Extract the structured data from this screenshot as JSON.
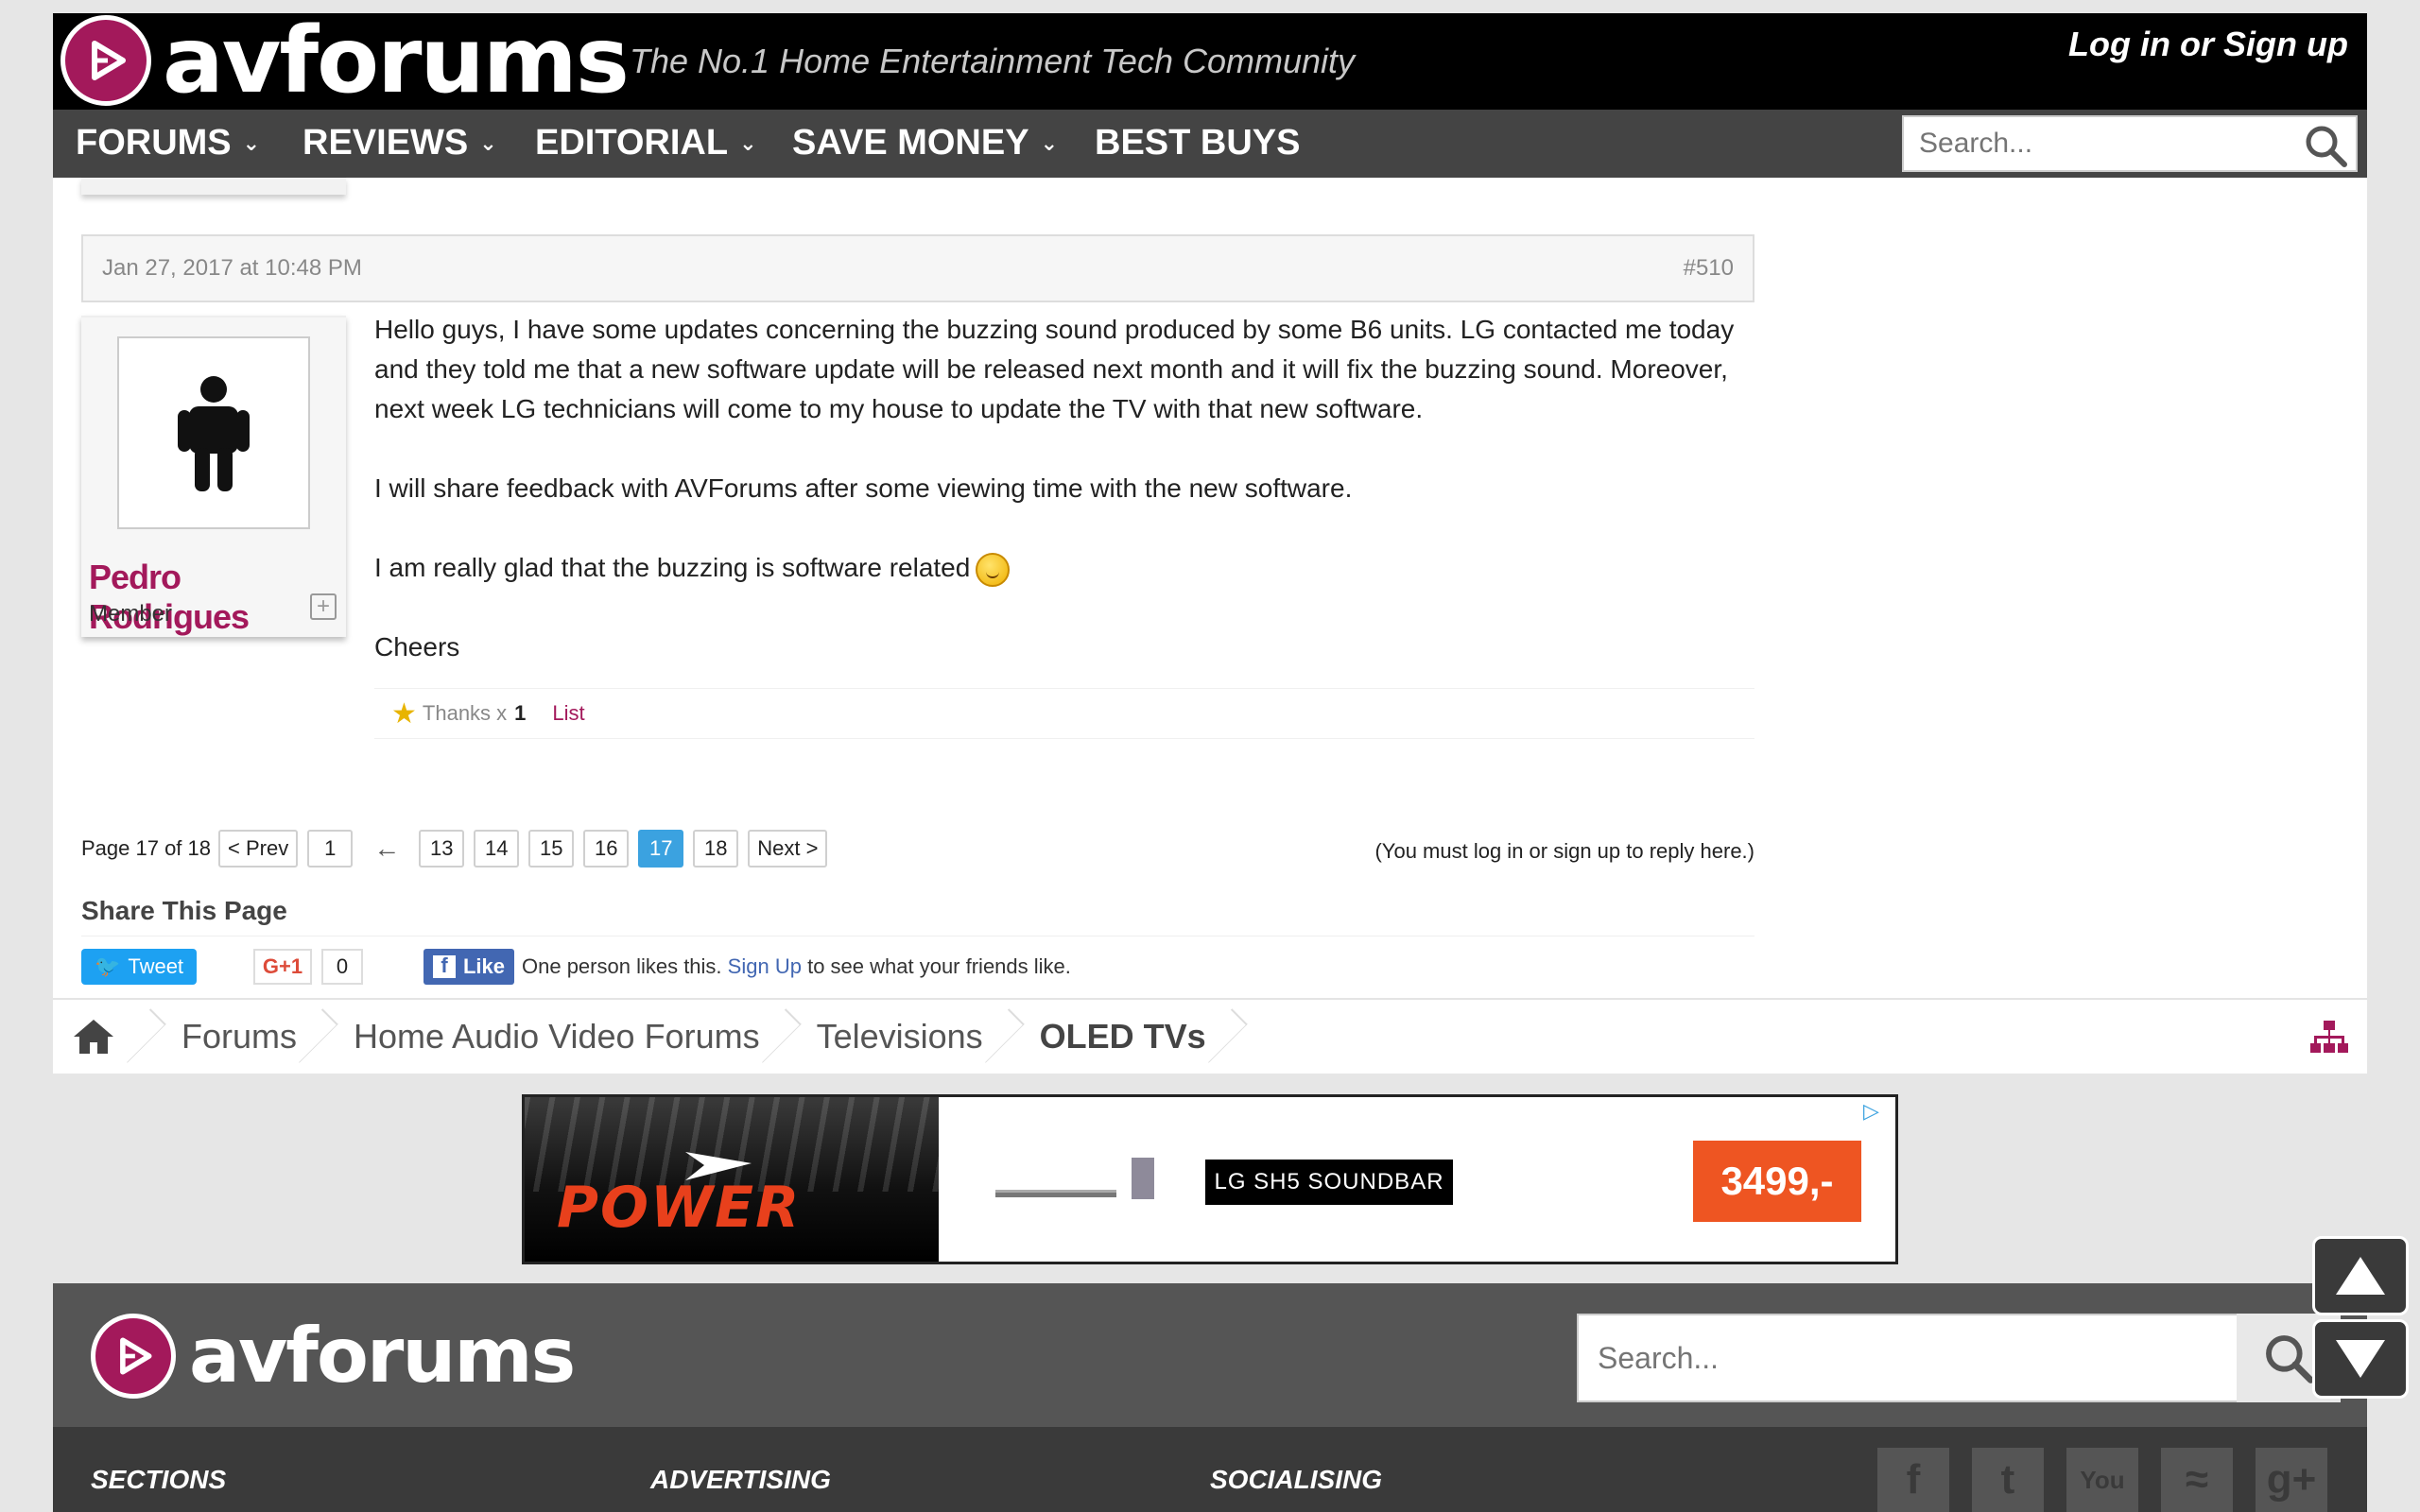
{
  "header": {
    "logo_text": "avforums",
    "tagline": "The No.1 Home Entertainment Tech Community",
    "login_label": "Log in or Sign up"
  },
  "nav": {
    "items": [
      {
        "label": "FORUMS",
        "has_dropdown": true
      },
      {
        "label": "REVIEWS",
        "has_dropdown": true
      },
      {
        "label": "EDITORIAL",
        "has_dropdown": true
      },
      {
        "label": "SAVE MONEY",
        "has_dropdown": true
      },
      {
        "label": "BEST BUYS",
        "has_dropdown": false
      }
    ],
    "dropdown_glyph": "⌄",
    "search_placeholder": "Search..."
  },
  "post": {
    "date": "Jan 27, 2017 at 10:48 PM",
    "number": "#510",
    "author": {
      "name": "Pedro Rodrigues",
      "title": "Member",
      "expand_glyph": "+"
    },
    "paragraphs": [
      "Hello guys, I have some updates concerning the buzzing sound produced by some B6 units. LG contacted me today and they told me that a new software update will be released next month and it will fix the buzzing sound. Moreover, next week LG technicians will come to my house to update the TV with that new software.",
      "I will share feedback with AVForums after some viewing time with the new software.",
      "I am really glad that the buzzing is software related",
      "Cheers"
    ],
    "likes": {
      "label": "Thanks x",
      "count": "1",
      "list_label": "List"
    }
  },
  "pagination": {
    "page_label": "Page 17 of 18",
    "prev_label": "< Prev",
    "first": "1",
    "separator": "←",
    "pages": [
      "13",
      "14",
      "15",
      "16",
      "17",
      "18"
    ],
    "current": "17",
    "next_label": "Next >",
    "reply_note": "(You must log in or sign up to reply here.)"
  },
  "share": {
    "title": "Share This Page",
    "tweet_label": "Tweet",
    "gplus_label": "G+1",
    "gplus_count": "0",
    "fb_like_label": "Like",
    "fb_text_before": "One person likes this.",
    "fb_signup": "Sign Up",
    "fb_text_after": "to see what your friends like."
  },
  "breadcrumb": {
    "items": [
      "Forums",
      "Home Audio Video Forums",
      "Televisions",
      "OLED TVs"
    ]
  },
  "ad": {
    "brand": "POWER",
    "product_name": "LG SH5 SOUNDBAR",
    "price": "3499,-",
    "ad_choice_glyph": "▷"
  },
  "footer": {
    "logo_text": "avforums",
    "search_placeholder": "Search...",
    "headings": [
      "SECTIONS",
      "ADVERTISING",
      "SOCIALISING"
    ],
    "social": [
      {
        "icon": "facebook-icon",
        "glyph": "f"
      },
      {
        "icon": "twitter-icon",
        "glyph": "t"
      },
      {
        "icon": "youtube-icon",
        "glyph": "You"
      },
      {
        "icon": "rss-icon",
        "glyph": "≈"
      },
      {
        "icon": "google-plus-icon",
        "glyph": "g+"
      }
    ]
  },
  "colors": {
    "brand": "#a3195b",
    "current_page": "#3ba2e0",
    "ad_price": "#ee5522",
    "twitter": "#1da1f2",
    "facebook": "#4267b2"
  }
}
